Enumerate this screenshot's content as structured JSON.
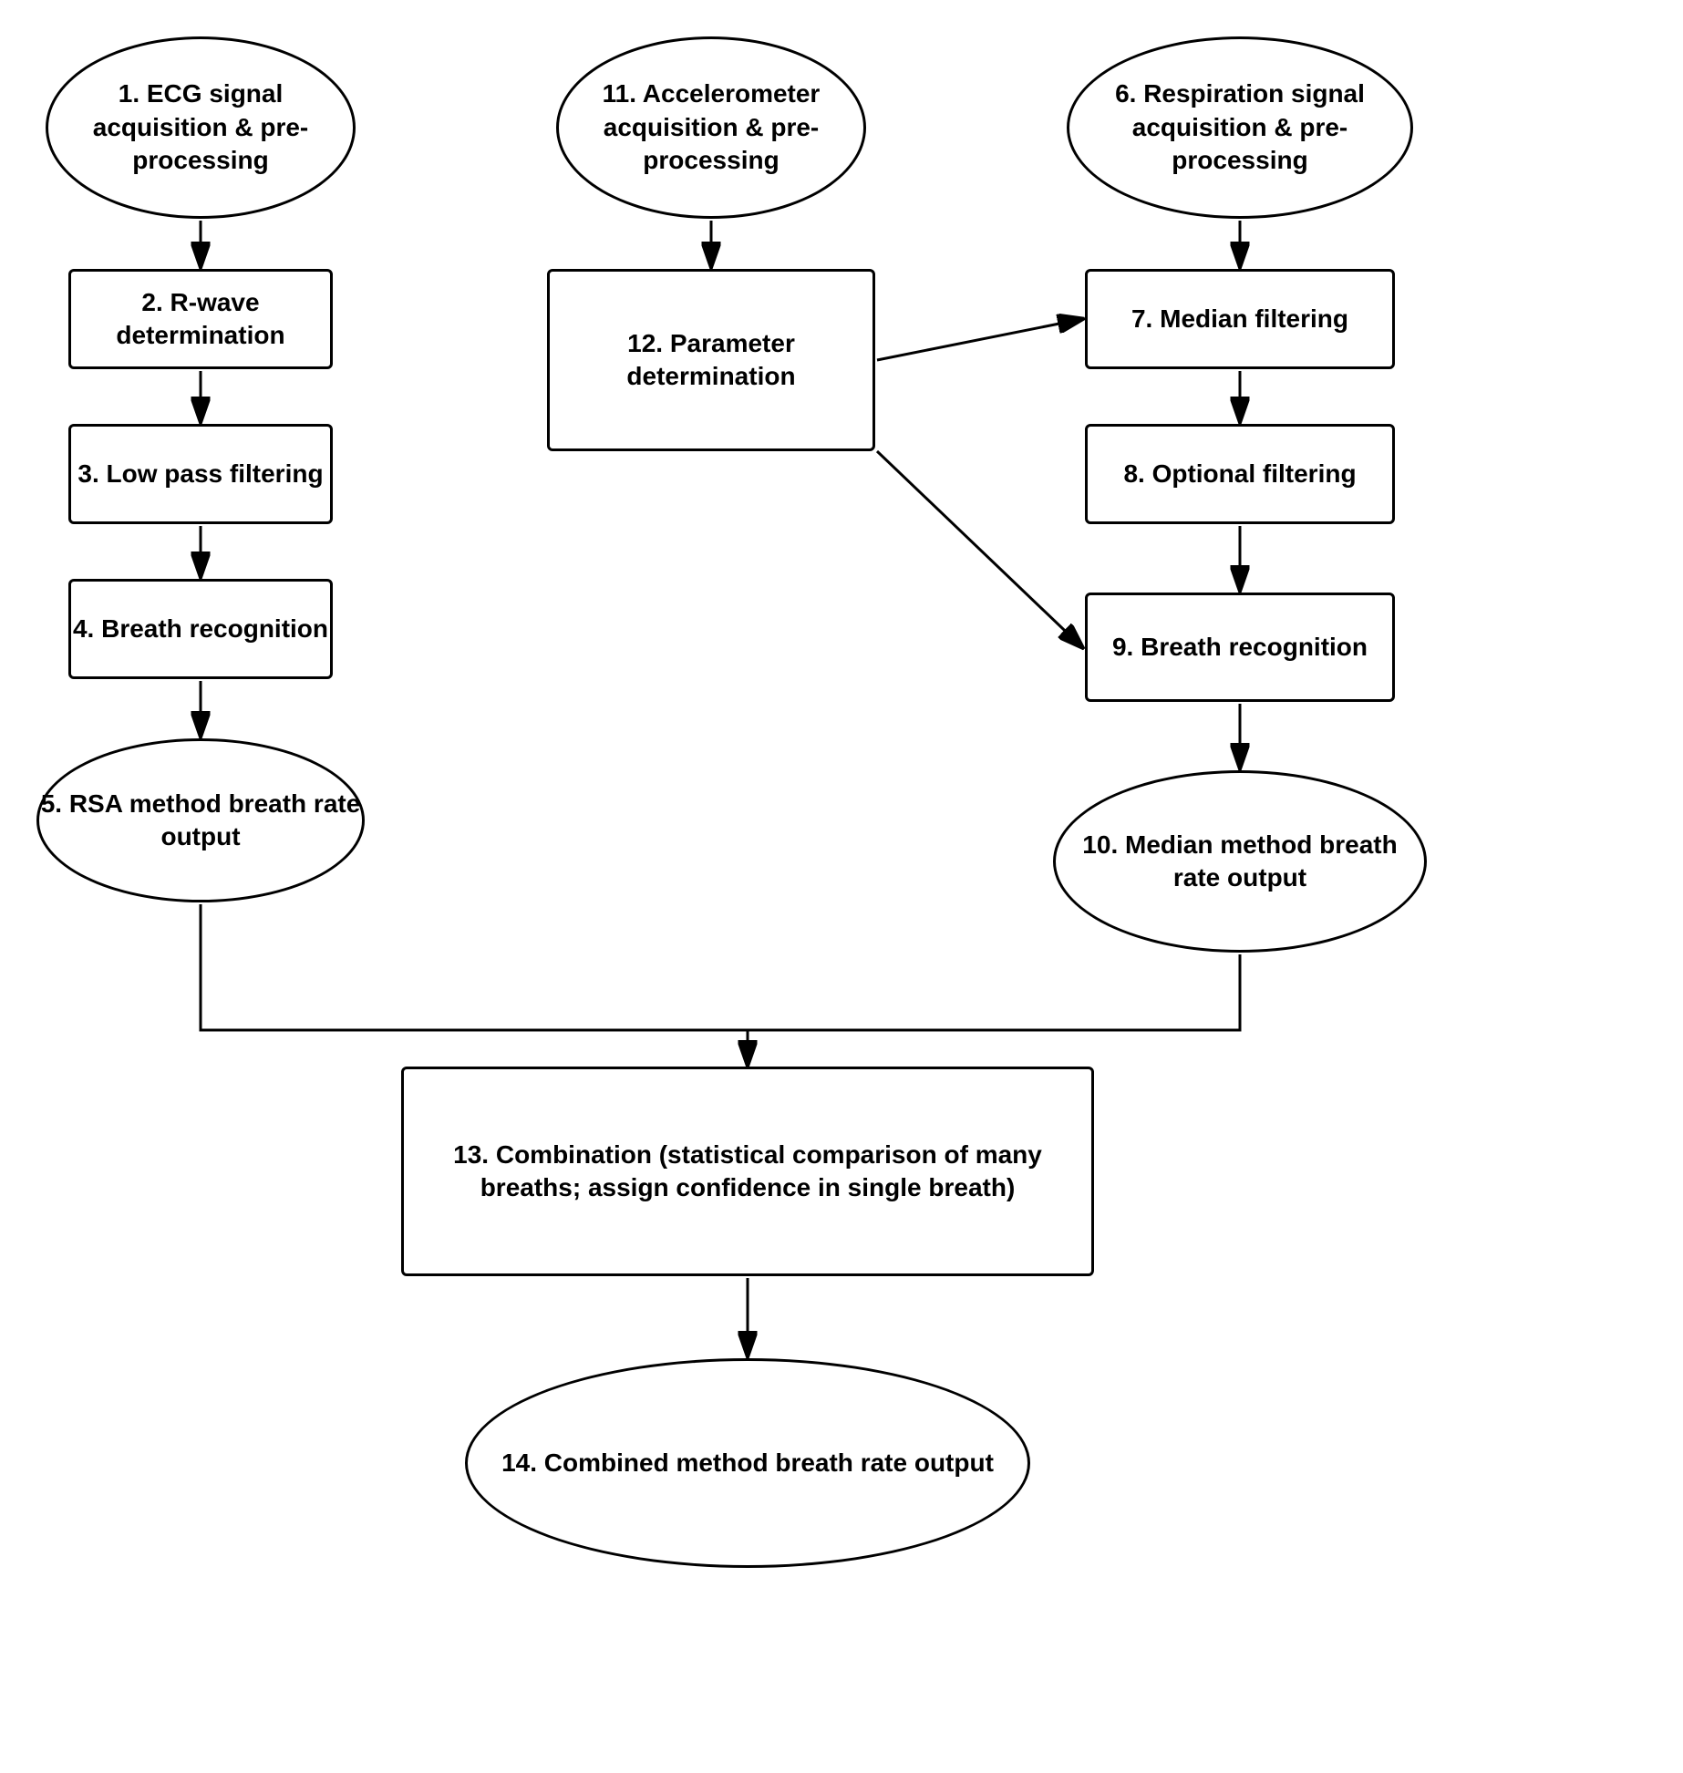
{
  "nodes": {
    "n1": {
      "label": "1. ECG signal acquisition & pre-processing",
      "type": "ellipse"
    },
    "n2": {
      "label": "2. R-wave determination",
      "type": "rect"
    },
    "n3": {
      "label": "3. Low pass filtering",
      "type": "rect"
    },
    "n4": {
      "label": "4. Breath recognition",
      "type": "rect"
    },
    "n5": {
      "label": "5. RSA method breath rate output",
      "type": "ellipse"
    },
    "n6": {
      "label": "6. Respiration signal acquisition & pre-processing",
      "type": "ellipse"
    },
    "n7": {
      "label": "7. Median filtering",
      "type": "rect"
    },
    "n8": {
      "label": "8. Optional filtering",
      "type": "rect"
    },
    "n9": {
      "label": "9. Breath recognition",
      "type": "rect"
    },
    "n10": {
      "label": "10. Median method breath rate output",
      "type": "ellipse"
    },
    "n11": {
      "label": "11. Accelerometer acquisition & pre-processing",
      "type": "ellipse"
    },
    "n12": {
      "label": "12. Parameter determination",
      "type": "rect"
    },
    "n13": {
      "label": "13. Combination (statistical comparison of many breaths; assign confidence in single breath)",
      "type": "rect"
    },
    "n14": {
      "label": "14. Combined method breath rate output",
      "type": "ellipse"
    }
  }
}
